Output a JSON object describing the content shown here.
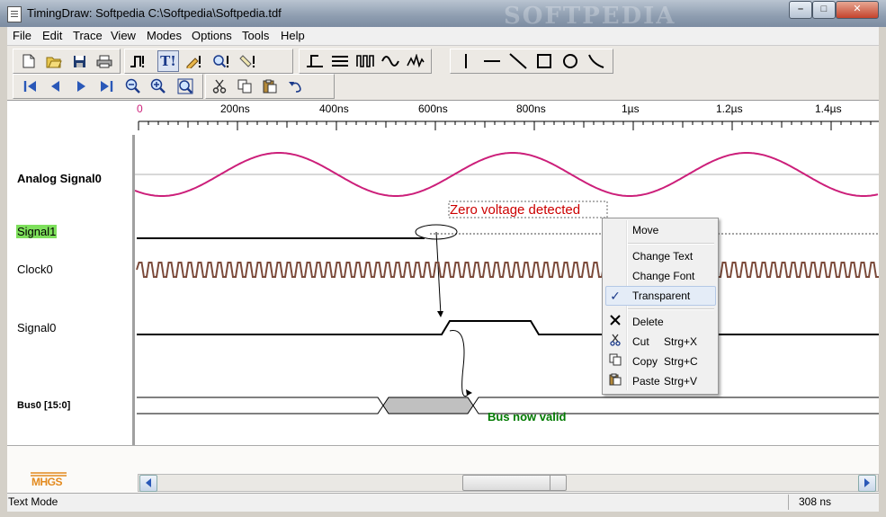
{
  "window": {
    "title": "TimingDraw: Softpedia  C:\\Softpedia\\Softpedia.tdf",
    "watermark": "SOFTPEDIA",
    "controls": {
      "minimize": "–",
      "maximize": "□",
      "close": "✕"
    }
  },
  "menu": [
    "File",
    "Edit",
    "Trace",
    "View",
    "Modes",
    "Options",
    "Tools",
    "Help"
  ],
  "toolbar1": {
    "file_icons": [
      "new-file-icon",
      "open-folder-icon",
      "save-icon",
      "print-icon"
    ],
    "mode_icons": [
      "trace-mode-icon",
      "text-mode-icon",
      "edit-mode-icon",
      "zoom-mode-icon",
      "measure-mode-icon"
    ],
    "signal_icons": [
      "clock-signal-icon",
      "bus-signal-icon",
      "pulse-train-icon",
      "analog-signal-icon",
      "glitch-signal-icon"
    ],
    "shape_icons": [
      "vertical-line-icon",
      "horizontal-line-icon",
      "diagonal-line-icon",
      "rectangle-icon",
      "circle-icon",
      "curve-icon"
    ]
  },
  "toolbar2": {
    "nav_icons": [
      "go-first-icon",
      "go-previous-icon",
      "go-next-icon",
      "go-last-icon",
      "zoom-out-icon",
      "zoom-in-icon",
      "zoom-fit-icon"
    ],
    "edit_icons": [
      "cut-icon",
      "copy-icon",
      "paste-icon",
      "undo-icon"
    ]
  },
  "ruler": {
    "labels": [
      "0",
      "200ns",
      "400ns",
      "600ns",
      "800ns",
      "1µs",
      "1.2µs",
      "1.4µs"
    ]
  },
  "signals": [
    {
      "name": "Analog Signal0",
      "type": "analog"
    },
    {
      "name": "Signal1",
      "type": "digital",
      "selected": true
    },
    {
      "name": "Clock0",
      "type": "clock"
    },
    {
      "name": "Signal0",
      "type": "digital"
    },
    {
      "name": "Bus0 [15:0]",
      "type": "bus"
    }
  ],
  "annotations": {
    "zero_voltage": "Zero voltage detected",
    "bus_valid": "Bus now valid"
  },
  "colors": {
    "analog": "#cc1f7a",
    "clock": "#7b4a3a",
    "zero_text": "#cc0000",
    "bus_text": "#007a00",
    "selected_bg": "#7ee05c",
    "bus_fill": "#c0c0c0"
  },
  "context_menu": {
    "items": [
      {
        "label": "Move",
        "shortcut": "",
        "icon": ""
      },
      {
        "label": "Change Text",
        "shortcut": "",
        "icon": ""
      },
      {
        "label": "Change Font",
        "shortcut": "",
        "icon": ""
      },
      {
        "label": "Transparent",
        "shortcut": "",
        "icon": "check-icon",
        "checked": true
      },
      {
        "label": "Delete",
        "shortcut": "",
        "icon": "delete-x-icon"
      },
      {
        "label": "Cut",
        "shortcut": "Strg+X",
        "icon": "cut-icon"
      },
      {
        "label": "Copy",
        "shortcut": "Strg+C",
        "icon": "copy-icon"
      },
      {
        "label": "Paste",
        "shortcut": "Strg+V",
        "icon": "paste-icon"
      }
    ]
  },
  "logo": "MHGS",
  "status": {
    "mode": "Text Mode",
    "time": "308 ns"
  }
}
